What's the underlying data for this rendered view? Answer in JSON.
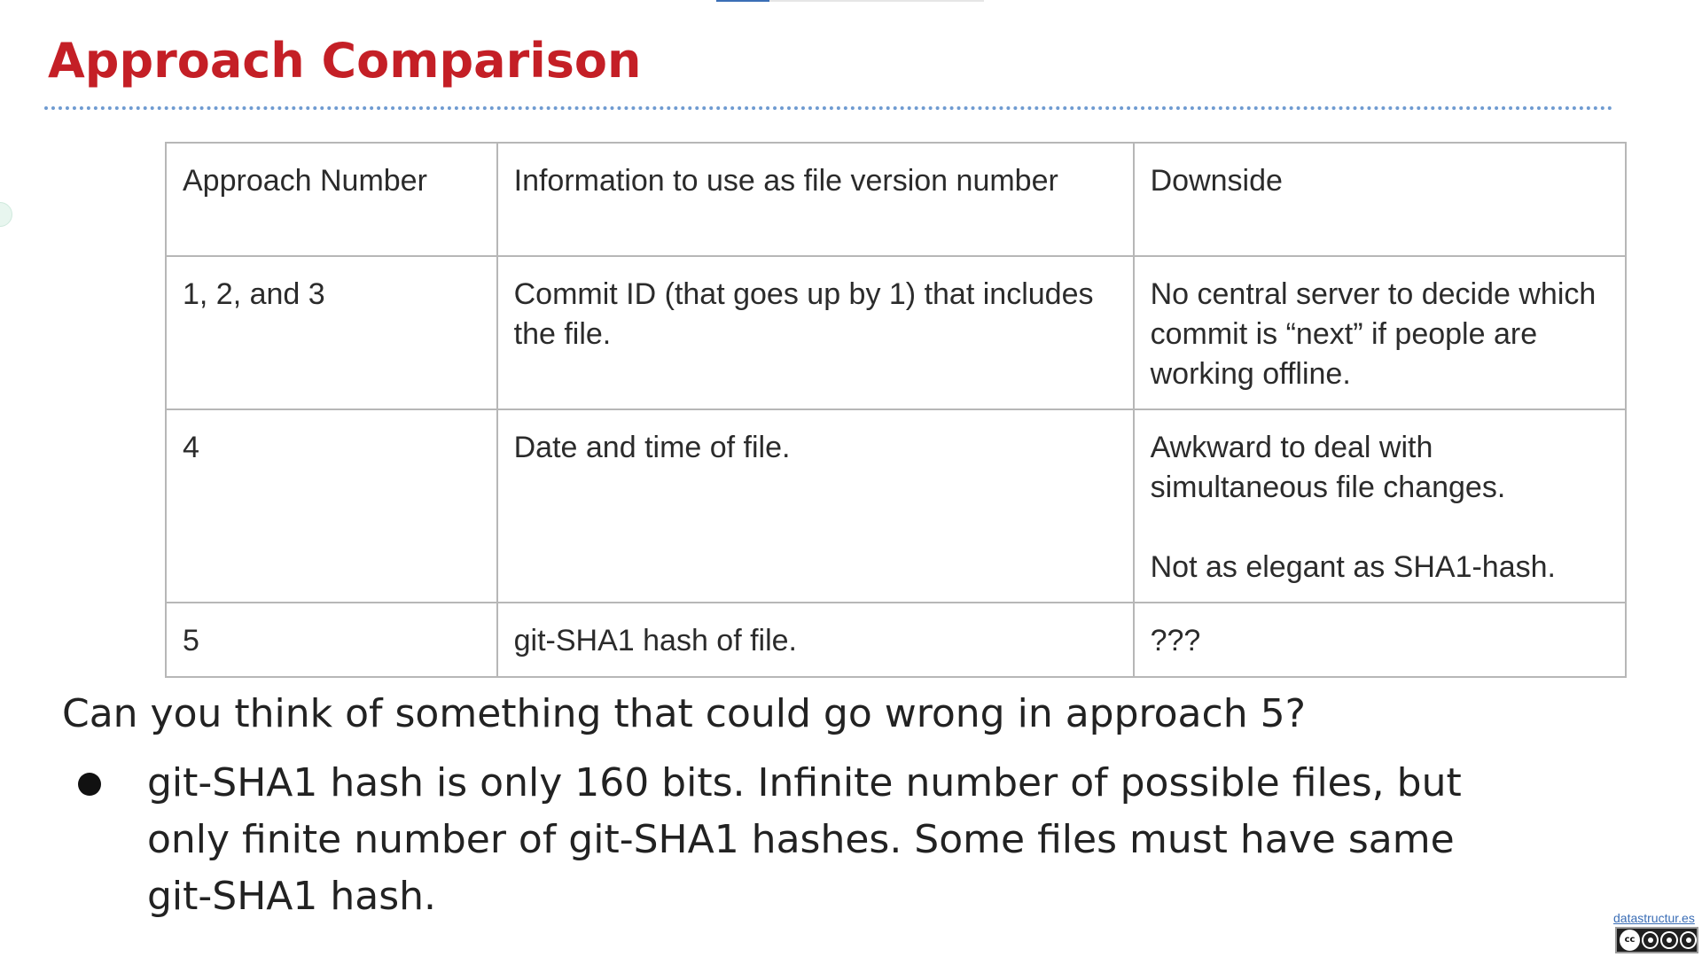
{
  "slide": {
    "title": "Approach Comparison",
    "table": {
      "headers": [
        "Approach Number",
        "Information to use as file version number",
        "Downside"
      ],
      "rows": [
        {
          "approach": "1, 2, and 3",
          "information": "Commit ID (that goes up by 1) that includes the file.",
          "downside": "No central server to decide which commit is “next” if people are working offline."
        },
        {
          "approach": "4",
          "information": "Date and time of file.",
          "downside": "Awkward to deal with simultaneous file changes.",
          "downside_extra": "Not as elegant as SHA1-hash."
        },
        {
          "approach": "5",
          "information": "git-SHA1 hash of file.",
          "downside": "???"
        }
      ]
    },
    "question": "Can you think of something that could go wrong in approach 5?",
    "bullets": [
      "git-SHA1 hash is only 160 bits. Infinite number of possible files, but only finite number of git-SHA1 hashes. Some files must have same git-SHA1 hash."
    ]
  },
  "footer": {
    "link_text": "datastructur.es",
    "license_badge": "cc-by-nc-sa-icon"
  },
  "colors": {
    "title": "#c41f26",
    "rule": "#6f9bd1",
    "table_border": "#b7b7b7",
    "link": "#3a6db5"
  }
}
